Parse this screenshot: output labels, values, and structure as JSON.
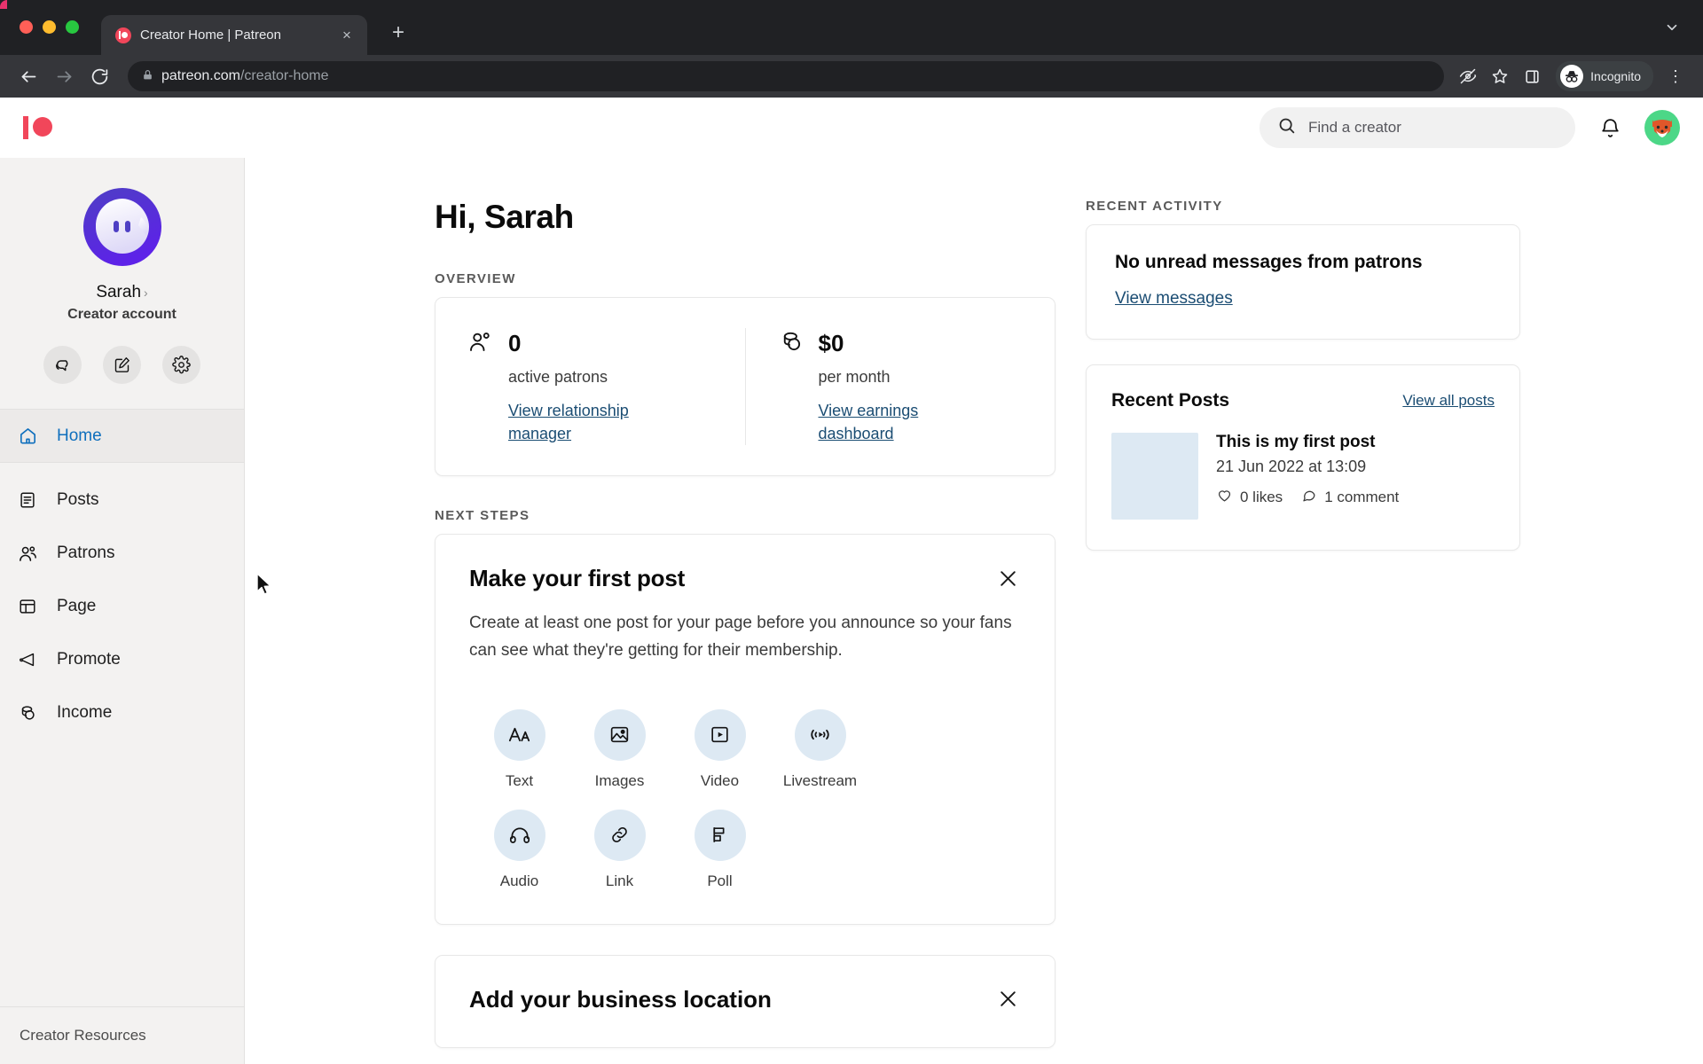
{
  "browser": {
    "tab": {
      "title": "Creator Home | Patreon",
      "favicon": "patreon-favicon",
      "close": "×"
    },
    "new_tab_label": "+",
    "tabstrip_caret": "⌄",
    "back_label": "←",
    "forward_label": "→",
    "reload_label": "⟳",
    "url_domain": "patreon.com",
    "url_path": "/creator-home",
    "lock": "🔒",
    "profile_chip": "Incognito",
    "menu_label": "⋮"
  },
  "header": {
    "logo": "patreon-logo",
    "search_placeholder": "Find a creator",
    "bell": "notifications-bell",
    "avatar": "user-avatar-fox"
  },
  "sidebar": {
    "profile": {
      "avatar": "ghost-avatar",
      "name": "Sarah",
      "chevron": "›",
      "role": "Creator account"
    },
    "quick_actions": [
      {
        "name": "messages-icon",
        "label": "Messages"
      },
      {
        "name": "compose-icon",
        "label": "Create post"
      },
      {
        "name": "settings-gear-icon",
        "label": "Settings"
      }
    ],
    "nav": [
      {
        "label": "Home",
        "icon": "home-icon",
        "active": true
      },
      {
        "label": "Posts",
        "icon": "posts-icon",
        "active": false
      },
      {
        "label": "Patrons",
        "icon": "patrons-icon",
        "active": false
      },
      {
        "label": "Page",
        "icon": "page-icon",
        "active": false
      },
      {
        "label": "Promote",
        "icon": "promote-megaphone-icon",
        "active": false
      },
      {
        "label": "Income",
        "icon": "income-coins-icon",
        "active": false
      }
    ],
    "footer_label": "Creator Resources"
  },
  "main": {
    "greeting": "Hi, Sarah",
    "overview_label": "OVERVIEW",
    "overview": [
      {
        "icon": "patrons-icon",
        "value": "0",
        "caption": "active patrons",
        "link": "View relationship manager"
      },
      {
        "icon": "income-coins-icon",
        "value": "$0",
        "caption": "per month",
        "link": "View earnings dashboard"
      }
    ],
    "next_steps_label": "NEXT STEPS",
    "first_post_card": {
      "title": "Make your first post",
      "close": "close-icon",
      "body": "Create at least one post for your page before you announce so your fans can see what they're getting for their membership.",
      "post_types": [
        {
          "label": "Text",
          "icon": "text-icon"
        },
        {
          "label": "Images",
          "icon": "image-icon"
        },
        {
          "label": "Video",
          "icon": "video-icon"
        },
        {
          "label": "Livestream",
          "icon": "livestream-icon"
        },
        {
          "label": "Audio",
          "icon": "audio-headphones-icon"
        },
        {
          "label": "Link",
          "icon": "link-icon"
        },
        {
          "label": "Poll",
          "icon": "poll-icon"
        }
      ]
    },
    "business_card": {
      "title": "Add your business location",
      "close": "close-icon"
    }
  },
  "activity": {
    "label": "RECENT ACTIVITY",
    "messages_card": {
      "title": "No unread messages from patrons",
      "link": "View messages"
    },
    "posts_card": {
      "title": "Recent Posts",
      "view_all": "View all posts",
      "post": {
        "thumbnail": "post-thumbnail",
        "title": "This is my first post",
        "date": "21 Jun 2022 at 13:09",
        "likes": "0 likes",
        "comments": "1 comment"
      }
    }
  },
  "colors": {
    "brand": "#f1465a",
    "link": "#1b4d73",
    "active_nav": "#0f6fbd",
    "bubble": "#dde9f3",
    "sidebar_bg": "#f3f2f1"
  }
}
